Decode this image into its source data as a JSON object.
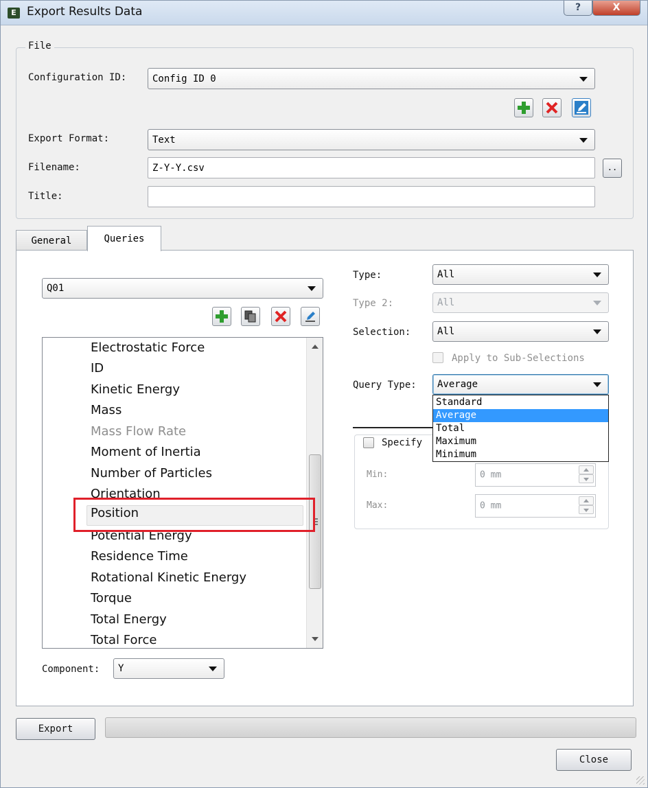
{
  "window": {
    "title": "Export Results Data",
    "app_icon_glyph": "E",
    "help_glyph": "?",
    "close_glyph": "X"
  },
  "file_group": {
    "legend": "File",
    "configuration_id_label": "Configuration ID:",
    "configuration_id_value": "Config ID 0",
    "export_format_label": "Export Format:",
    "export_format_value": "Text",
    "filename_label": "Filename:",
    "filename_value": "Z-Y-Y.csv",
    "browse_label": "..",
    "title_label": "Title:",
    "title_value": ""
  },
  "tabs": [
    {
      "label": "General",
      "active": false
    },
    {
      "label": "Queries",
      "active": true
    }
  ],
  "queries": {
    "query_value": "Q01",
    "attributes": [
      {
        "label": "Electrostatic Force",
        "state": "normal"
      },
      {
        "label": "ID",
        "state": "normal"
      },
      {
        "label": "Kinetic Energy",
        "state": "normal"
      },
      {
        "label": "Mass",
        "state": "normal"
      },
      {
        "label": "Mass Flow Rate",
        "state": "disabled"
      },
      {
        "label": "Moment of Inertia",
        "state": "normal"
      },
      {
        "label": "Number of Particles",
        "state": "normal"
      },
      {
        "label": "Orientation",
        "state": "normal"
      },
      {
        "label": "Position",
        "state": "selected"
      },
      {
        "label": "Potential Energy",
        "state": "normal"
      },
      {
        "label": "Residence Time",
        "state": "normal"
      },
      {
        "label": "Rotational Kinetic Energy",
        "state": "normal"
      },
      {
        "label": "Torque",
        "state": "normal"
      },
      {
        "label": "Total Energy",
        "state": "normal"
      },
      {
        "label": "Total Force",
        "state": "normal"
      }
    ],
    "component_label": "Component:",
    "component_value": "Y",
    "type_label": "Type:",
    "type_value": "All",
    "type2_label": "Type 2:",
    "type2_value": "All",
    "selection_label": "Selection:",
    "selection_value": "All",
    "apply_sub_label": "Apply to Sub-Selections",
    "query_type_label": "Query Type:",
    "query_type_value": "Average",
    "query_type_options": [
      {
        "label": "Standard",
        "selected": false
      },
      {
        "label": "Average",
        "selected": true
      },
      {
        "label": "Total",
        "selected": false
      },
      {
        "label": "Maximum",
        "selected": false
      },
      {
        "label": "Minimum",
        "selected": false
      }
    ],
    "specify_label": "Specify",
    "min_label": "Min:",
    "min_value": "0 mm",
    "max_label": "Max:",
    "max_value": "0 mm"
  },
  "footer": {
    "export_label": "Export",
    "close_label": "Close",
    "progress_fraction": 0
  },
  "colors": {
    "add": "#2f9e2f",
    "delete": "#e02424",
    "edit": "#2a7fc8",
    "highlight": "#e0202a",
    "selection": "#3399ff"
  }
}
